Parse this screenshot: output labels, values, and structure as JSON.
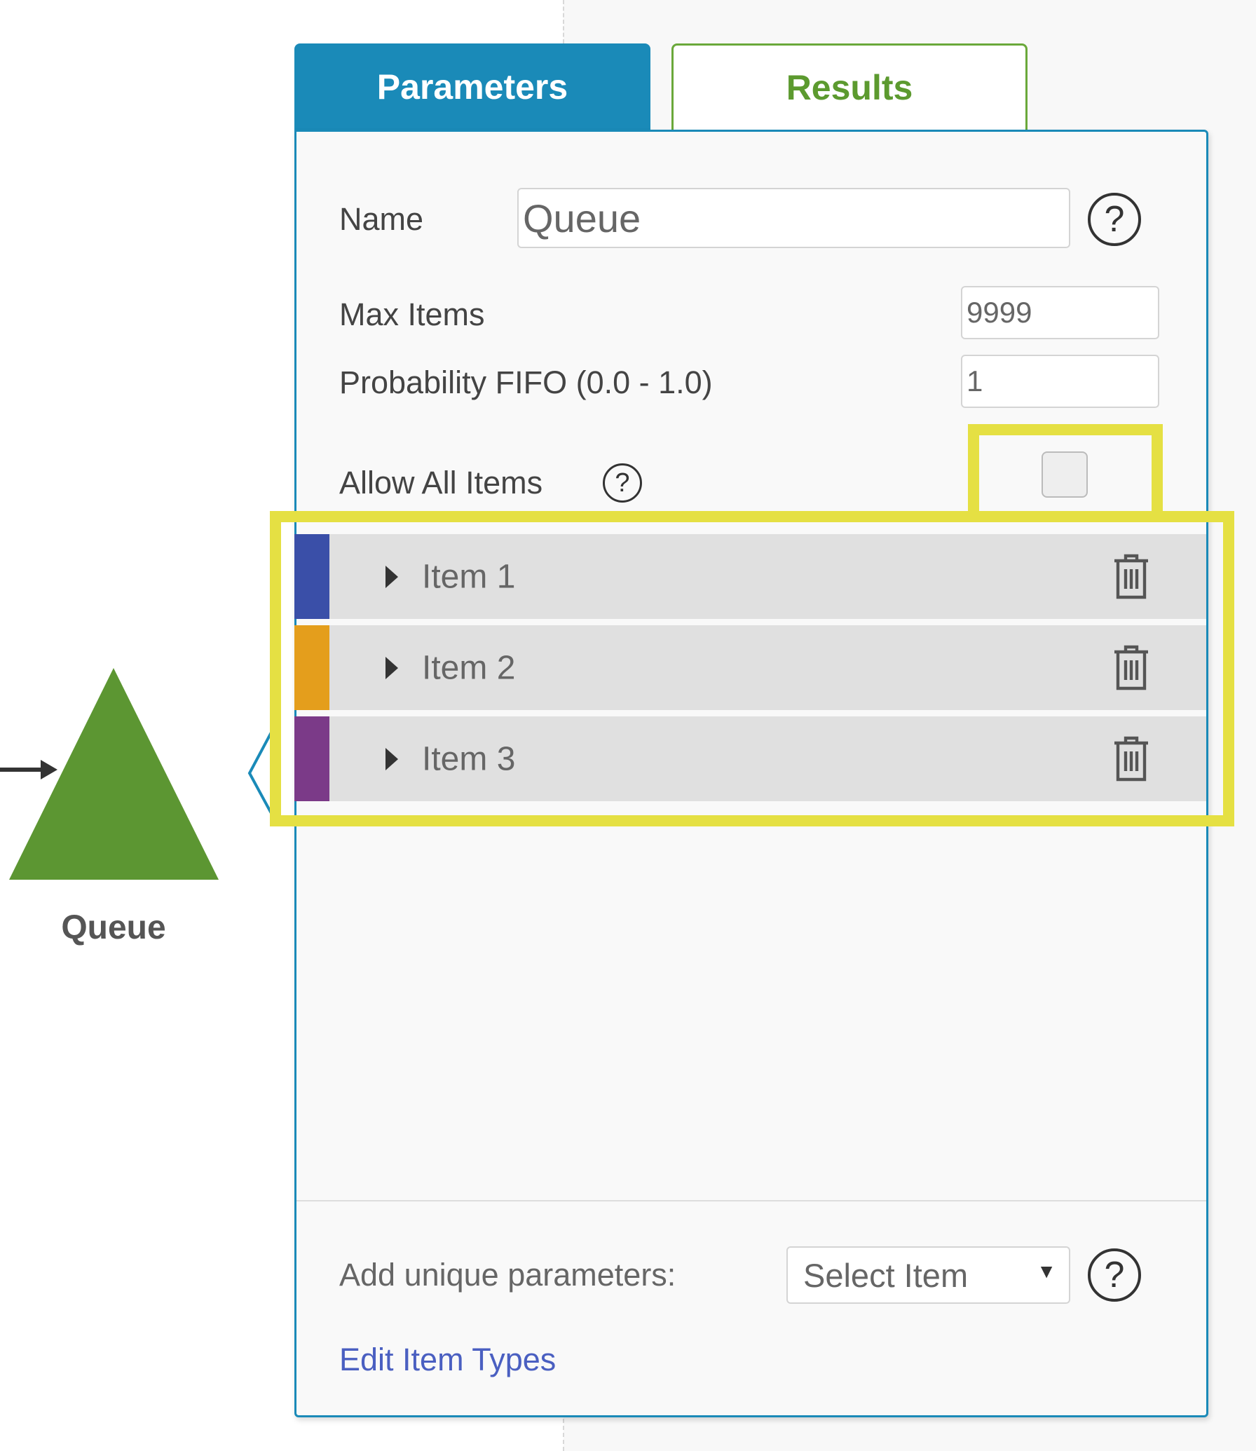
{
  "tabs": [
    {
      "label": "Parameters",
      "active": true
    },
    {
      "label": "Results",
      "active": false
    }
  ],
  "form": {
    "name_label": "Name",
    "name_value": "Queue",
    "max_items_label": "Max Items",
    "max_items_value": "9999",
    "fifo_label": "Probability FIFO (0.0 - 1.0)",
    "fifo_value": "1",
    "allow_all_label": "Allow All Items",
    "allow_all_checked": false
  },
  "items": [
    {
      "label": "Item 1",
      "color": "#3a4fa8"
    },
    {
      "label": "Item 2",
      "color": "#e49e1c"
    },
    {
      "label": "Item 3",
      "color": "#7b3a88"
    }
  ],
  "footer": {
    "add_label": "Add unique parameters:",
    "select_value": "Select Item",
    "edit_link": "Edit Item Types"
  },
  "canvas": {
    "node_label": "Queue",
    "node_color": "#5c9632",
    "accent": "#1a8ab8",
    "highlight": "#e5e043"
  }
}
